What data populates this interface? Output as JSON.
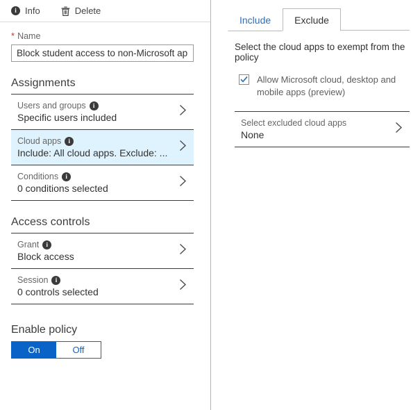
{
  "colors": {
    "accent_blue": "#0a64c8",
    "selected_row_bg": "#def3fd",
    "link_blue": "#2f6fb5",
    "required_star": "#c0392b",
    "rule": "#3b3b3b"
  },
  "toolbar": {
    "info_label": "Info",
    "info_icon": "info-circle-icon",
    "delete_label": "Delete",
    "delete_icon": "trash-icon"
  },
  "name_field": {
    "label": "Name",
    "required_marker": "*",
    "value": "Block student access to non-Microsoft apps",
    "placeholder": "Name"
  },
  "assignments": {
    "title": "Assignments",
    "rows": [
      {
        "label": "Users and groups",
        "value": "Specific users included",
        "info_icon": "info-circle-icon",
        "chevron": "chevron-right-icon",
        "selected": false
      },
      {
        "label": "Cloud apps",
        "value": "Include: All cloud apps. Exclude: ...",
        "info_icon": "info-circle-icon",
        "chevron": "chevron-right-icon",
        "selected": true
      },
      {
        "label": "Conditions",
        "value": "0 conditions selected",
        "info_icon": "info-circle-icon",
        "chevron": "chevron-right-icon",
        "selected": false
      }
    ]
  },
  "access_controls": {
    "title": "Access controls",
    "rows": [
      {
        "label": "Grant",
        "value": "Block access",
        "info_icon": "info-circle-icon",
        "chevron": "chevron-right-icon"
      },
      {
        "label": "Session",
        "value": "0 controls selected",
        "info_icon": "info-circle-icon",
        "chevron": "chevron-right-icon"
      }
    ]
  },
  "enable_policy": {
    "title": "Enable policy",
    "on_label": "On",
    "off_label": "Off",
    "selected": "On"
  },
  "cloud_apps_panel": {
    "tabs": [
      {
        "label": "Include",
        "active": false
      },
      {
        "label": "Exclude",
        "active": true
      }
    ],
    "description": "Select the cloud apps to exempt from the policy",
    "checkbox": {
      "label": "Allow Microsoft cloud, desktop and mobile apps (preview)",
      "checked": true,
      "icon": "checkmark-icon"
    },
    "select_row": {
      "label": "Select excluded cloud apps",
      "value": "None",
      "chevron": "chevron-right-icon"
    }
  }
}
